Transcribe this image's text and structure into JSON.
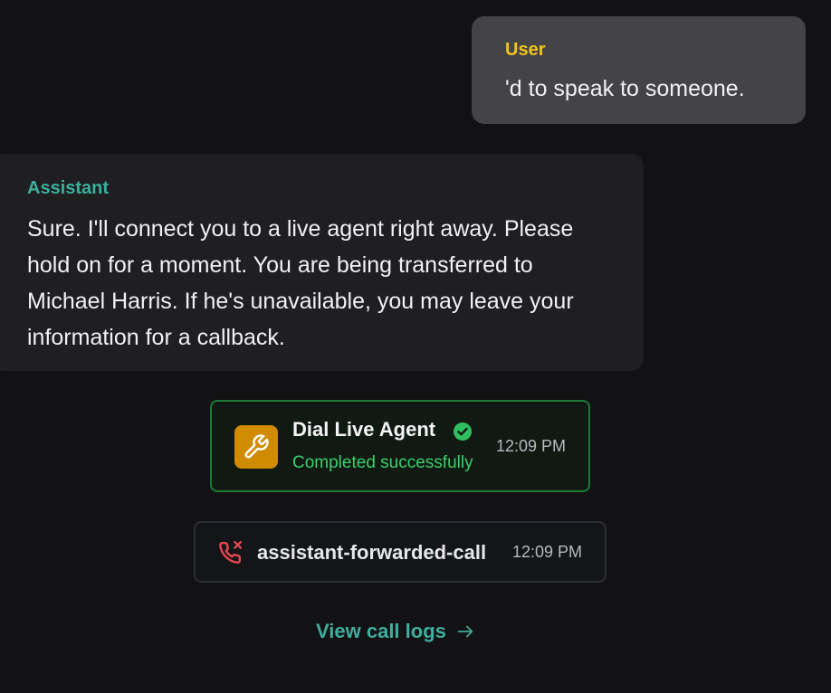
{
  "messages": {
    "user": {
      "label": "User",
      "text": "'d to speak to someone."
    },
    "assistant": {
      "label": "Assistant",
      "text": "Sure. I'll connect you to a live agent right away. Please hold on for a moment. You are being transferred to Michael Harris. If he's unavailable, you may leave your information for a callback."
    }
  },
  "tool_call": {
    "title": "Dial Live Agent",
    "status": "Completed successfully",
    "time": "12:09 PM",
    "icon": "wrench-icon",
    "status_icon": "check-circle-icon"
  },
  "forwarded_call": {
    "label": "assistant-forwarded-call",
    "time": "12:09 PM",
    "icon": "phone-missed-icon"
  },
  "links": {
    "view_call_logs": "View call logs",
    "arrow_icon": "arrow-right-icon"
  },
  "colors": {
    "background": "#121214",
    "user_label": "#f0c419",
    "assistant_label": "#39b09b",
    "success": "#3ccf6a",
    "tool_icon_bg": "#d18b00",
    "call_icon": "#e5484d",
    "link": "#3fae9c"
  }
}
